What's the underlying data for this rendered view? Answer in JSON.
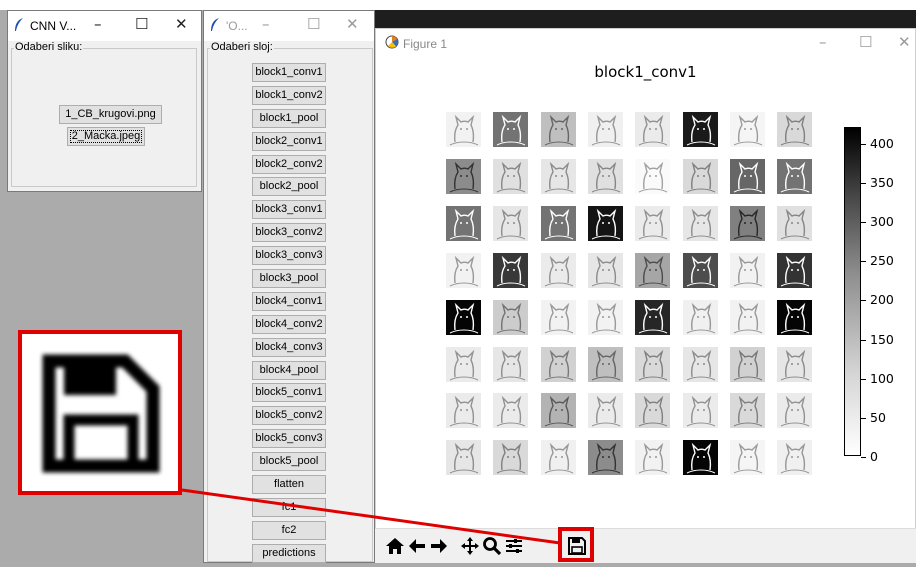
{
  "window1": {
    "title": "CNN V...",
    "group_label": "Odaberi sliku:",
    "buttons": [
      "1_CB_krugovi.png",
      "2_Macka.jpeg"
    ]
  },
  "window2": {
    "title": "'O...",
    "group_label": "Odaberi sloj:",
    "layers": [
      "block1_conv1",
      "block1_conv2",
      "block1_pool",
      "block2_conv1",
      "block2_conv2",
      "block2_pool",
      "block3_conv1",
      "block3_conv2",
      "block3_conv3",
      "block3_pool",
      "block4_conv1",
      "block4_conv2",
      "block4_conv3",
      "block4_pool",
      "block5_conv1",
      "block5_conv2",
      "block5_conv3",
      "block5_pool",
      "flatten",
      "fc1",
      "fc2",
      "predictions"
    ]
  },
  "figure": {
    "window_title": "Figure 1",
    "plot_title": "block1_conv1",
    "grid": {
      "rows": 8,
      "cols": 8
    },
    "tile_darkness": [
      [
        0.05,
        0.55,
        0.25,
        0.06,
        0.08,
        0.9,
        0.04,
        0.15
      ],
      [
        0.45,
        0.12,
        0.1,
        0.12,
        0.02,
        0.15,
        0.6,
        0.55
      ],
      [
        0.55,
        0.1,
        0.55,
        0.92,
        0.08,
        0.1,
        0.5,
        0.12
      ],
      [
        0.05,
        0.78,
        0.08,
        0.1,
        0.35,
        0.7,
        0.05,
        0.8
      ],
      [
        0.98,
        0.2,
        0.05,
        0.05,
        0.85,
        0.06,
        0.05,
        0.98
      ],
      [
        0.08,
        0.1,
        0.18,
        0.25,
        0.15,
        0.1,
        0.18,
        0.1
      ],
      [
        0.08,
        0.08,
        0.3,
        0.08,
        0.15,
        0.08,
        0.15,
        0.08
      ],
      [
        0.1,
        0.15,
        0.06,
        0.45,
        0.05,
        0.98,
        0.04,
        0.06
      ]
    ],
    "colorbar": {
      "min": 0,
      "max": 420,
      "ticks": [
        "400",
        "350",
        "300",
        "250",
        "200",
        "150",
        "100",
        "50",
        "0"
      ]
    },
    "toolbar": [
      "home-icon",
      "back-arrow-icon",
      "forward-arrow-icon",
      "pan-icon",
      "zoom-icon",
      "configure-subplots-icon",
      "save-icon"
    ]
  },
  "callout": {
    "icon": "save-icon",
    "highlight_color": "#e00000"
  }
}
